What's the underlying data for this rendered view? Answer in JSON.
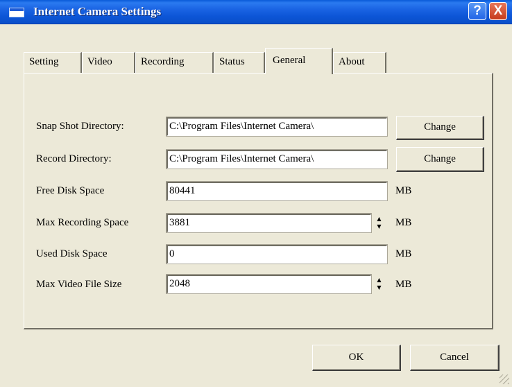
{
  "window": {
    "title": "Internet Camera Settings",
    "help_label": "?",
    "close_label": "X"
  },
  "tabs": [
    {
      "label": "Setting"
    },
    {
      "label": "Video"
    },
    {
      "label": "Recording"
    },
    {
      "label": "Status"
    },
    {
      "label": "General",
      "active": true
    },
    {
      "label": "About"
    }
  ],
  "general": {
    "snapshot": {
      "label": "Snap Shot Directory:",
      "value": "C:\\Program Files\\Internet Camera\\",
      "button": "Change"
    },
    "record": {
      "label": "Record Directory:",
      "value": "C:\\Program Files\\Internet Camera\\",
      "button": "Change"
    },
    "free_disk": {
      "label": "Free Disk Space",
      "value": "80441",
      "unit": "MB"
    },
    "max_recording": {
      "label": "Max Recording Space",
      "value": "3881",
      "unit": "MB"
    },
    "used_disk": {
      "label": "Used Disk Space",
      "value": "0",
      "unit": "MB"
    },
    "max_video": {
      "label": "Max Video File Size",
      "value": "2048",
      "unit": "MB"
    }
  },
  "buttons": {
    "ok": "OK",
    "cancel": "Cancel"
  }
}
